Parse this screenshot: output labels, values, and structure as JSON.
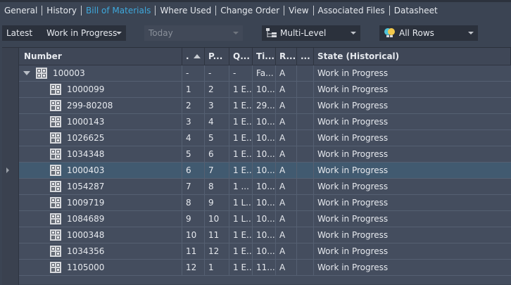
{
  "tabs": [
    {
      "label": "General"
    },
    {
      "label": "History"
    },
    {
      "label": "Bill of Materials",
      "active": true
    },
    {
      "label": "Where Used"
    },
    {
      "label": "Change Order"
    },
    {
      "label": "View"
    },
    {
      "label": "Associated Files"
    },
    {
      "label": "Datasheet"
    }
  ],
  "toolbar": {
    "revision_label": "Latest",
    "revision_value": "Work in Progress",
    "date_value": "Today",
    "view_value": "Multi-Level",
    "filter_value": "All Rows"
  },
  "columns": [
    "Number",
    ".",
    "P...",
    "Q...",
    "Ti...",
    "R...",
    "...",
    "State (Historical)"
  ],
  "root": {
    "number": "100003",
    "c1": "-",
    "c2": "-",
    "c3": "-",
    "c4": "Fa...",
    "c5": "A",
    "c6": "",
    "state": "Work in Progress"
  },
  "rows": [
    [
      "1000099",
      "1",
      "2",
      "1 E...",
      "10...",
      "A",
      "",
      "Work in Progress"
    ],
    [
      "299-80208",
      "2",
      "3",
      "1 E...",
      "29...",
      "A",
      "",
      "Work in Progress"
    ],
    [
      "1000143",
      "3",
      "4",
      "1 E...",
      "10...",
      "A",
      "",
      "Work in Progress"
    ],
    [
      "1026625",
      "4",
      "5",
      "1 E...",
      "10...",
      "A",
      "",
      "Work in Progress"
    ],
    [
      "1034348",
      "5",
      "6",
      "1 E...",
      "10...",
      "A",
      "",
      "Work in Progress"
    ],
    [
      "1000403",
      "6",
      "7",
      "1 E...",
      "10...",
      "A",
      "",
      "Work in Progress"
    ],
    [
      "1054287",
      "7",
      "8",
      "1 ...",
      "10...",
      "A",
      "",
      "Work in Progress"
    ],
    [
      "1009719",
      "8",
      "9",
      "1 L...",
      "10...",
      "A",
      "",
      "Work in Progress"
    ],
    [
      "1084689",
      "9",
      "10",
      "1 L...",
      "10...",
      "A",
      "",
      "Work in Progress"
    ],
    [
      "1000348",
      "10",
      "11",
      "1 E...",
      "10...",
      "A",
      "",
      "Work in Progress"
    ],
    [
      "1034356",
      "11",
      "12",
      "1 E...",
      "10...",
      "A",
      "",
      "Work in Progress"
    ],
    [
      "1105000",
      "12",
      "1",
      "1 E...",
      "11...",
      "A",
      "",
      "Work in Progress"
    ]
  ],
  "selected_row": 5,
  "colors": {
    "accent": "#3ea8dc",
    "selected": "#415a70"
  }
}
